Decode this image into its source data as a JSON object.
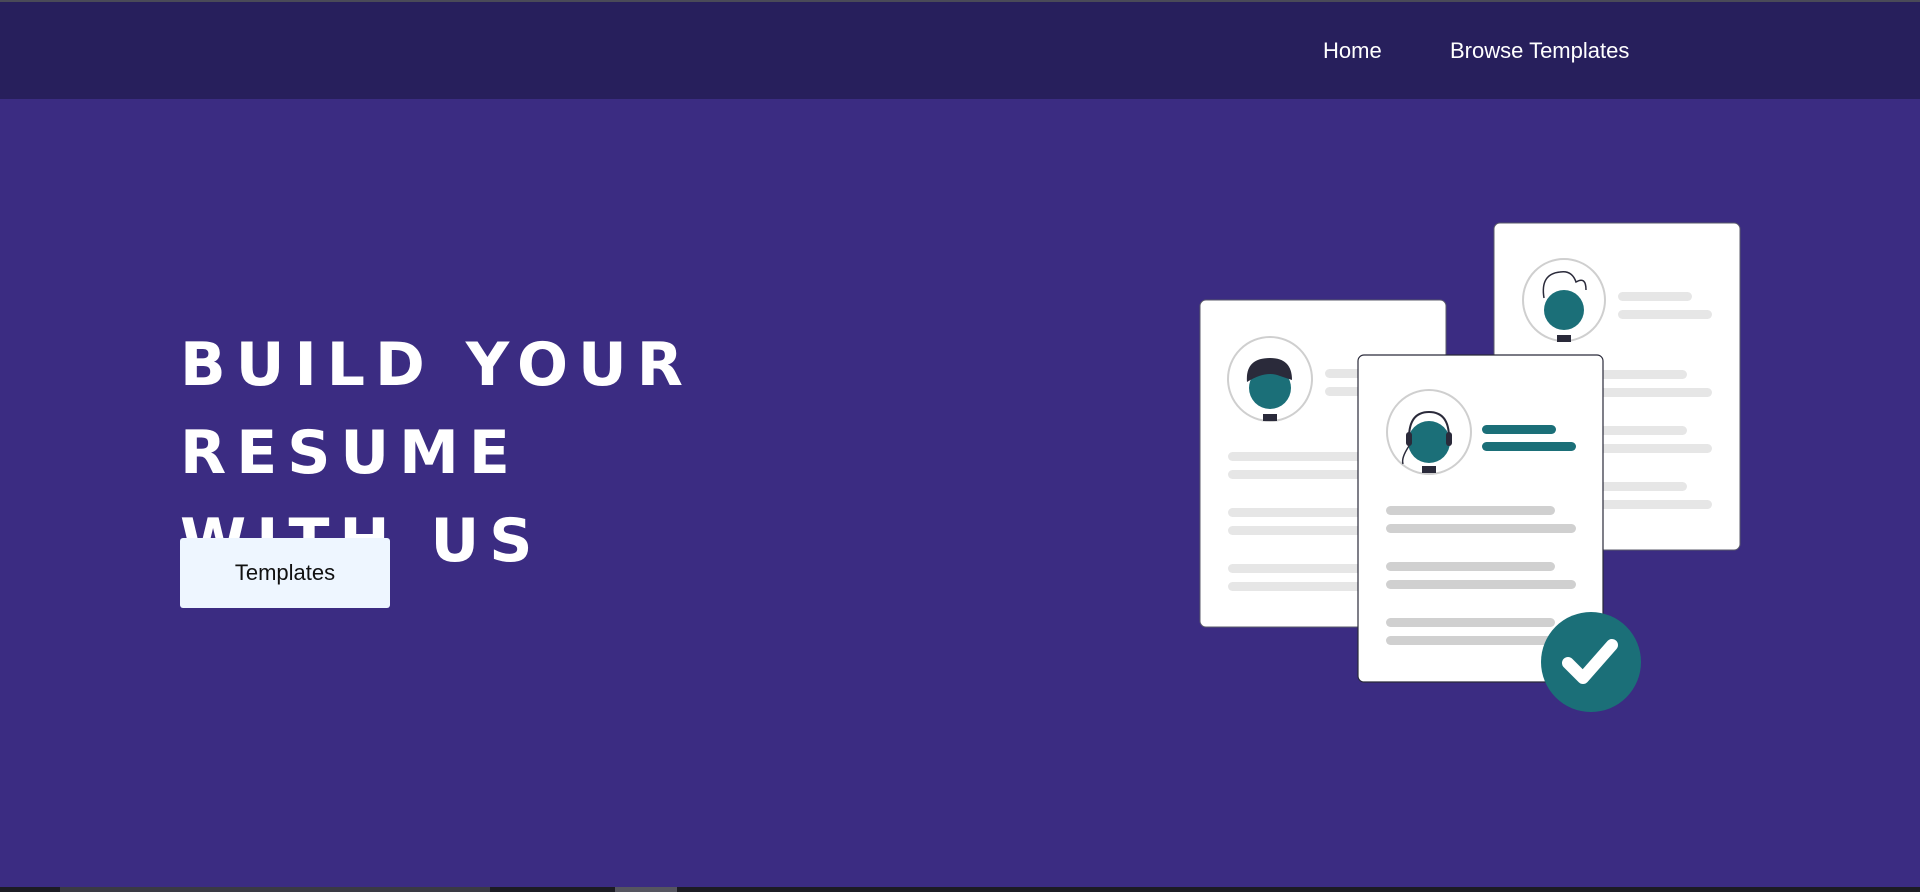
{
  "nav": {
    "home_label": "Home",
    "browse_label": "Browse Templates"
  },
  "hero": {
    "title_line1": "BUILD YOUR RESUME",
    "title_line2": "WITH US",
    "button_label": "Templates"
  },
  "colors": {
    "background": "#3b2c82",
    "navbar": "#271f5c",
    "accent_teal": "#1b6f78",
    "button_bg": "#eef6ff"
  },
  "icons": [
    "resume-card-icon",
    "avatar-icon",
    "checkmark-icon"
  ]
}
